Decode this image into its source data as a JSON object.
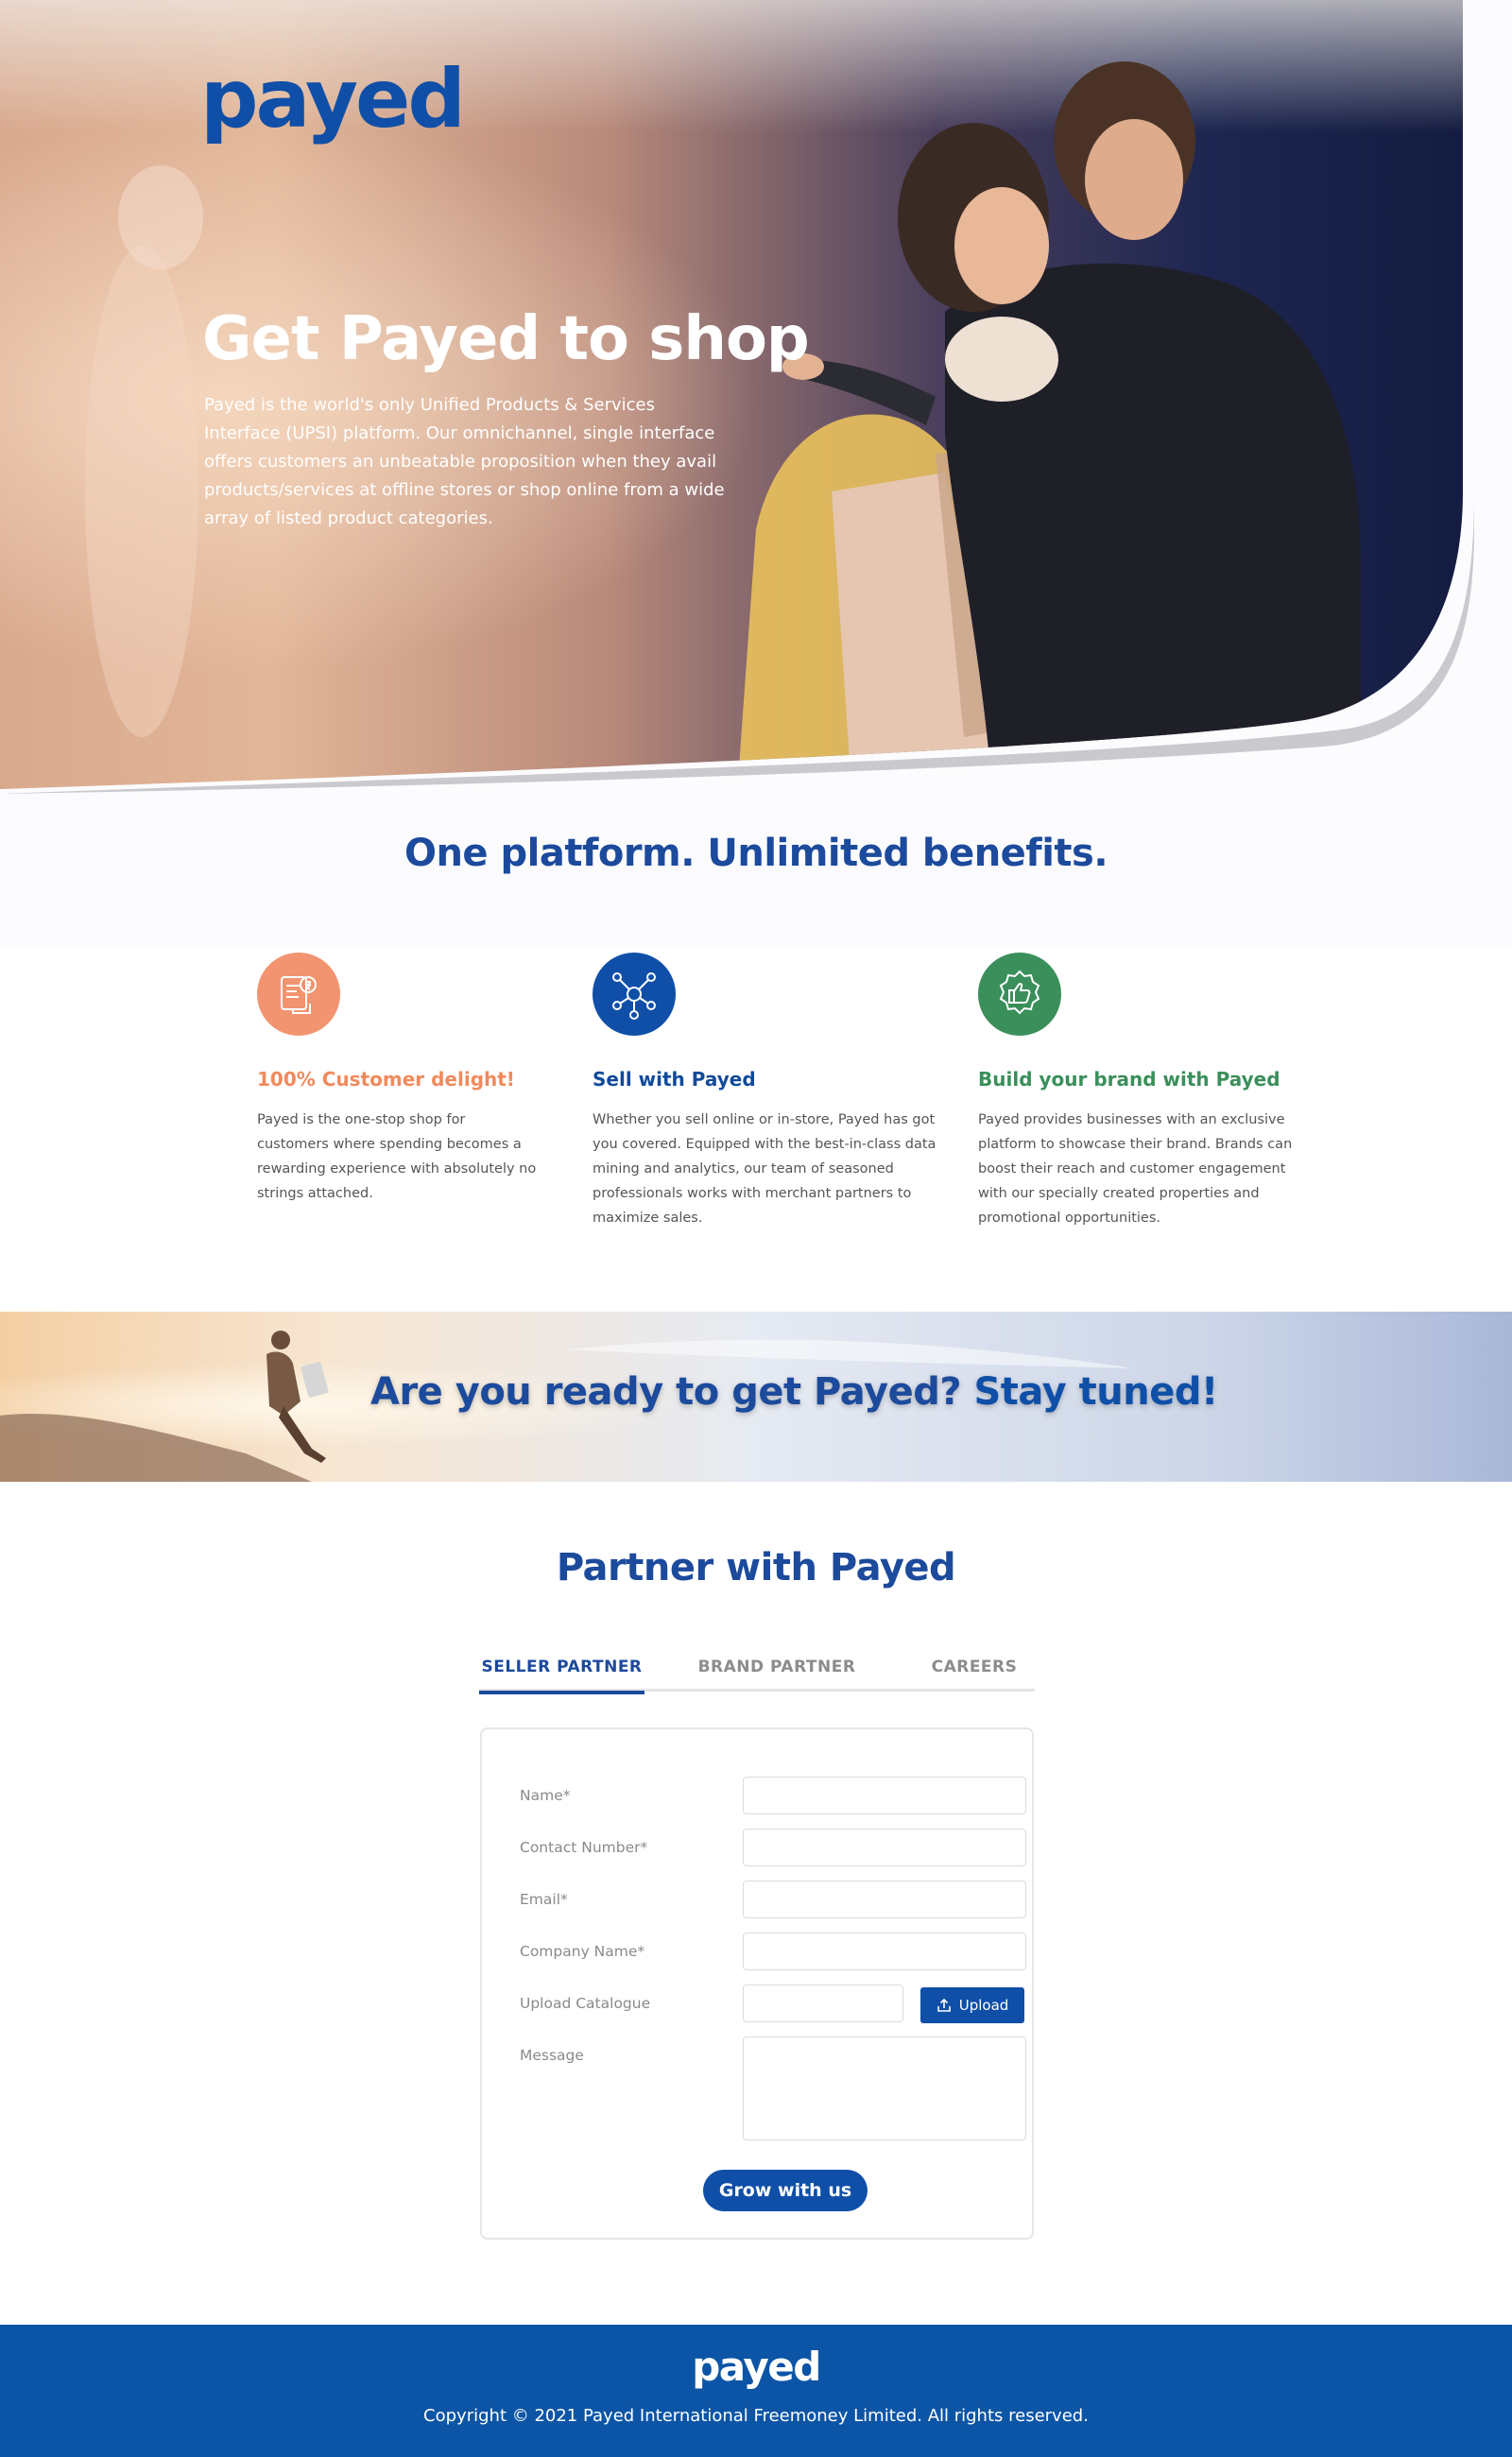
{
  "brand": {
    "logo_text": "payed",
    "color_primary": "#0f4fa8",
    "color_title": "#1c4a9c",
    "color_orange": "#f08a5c",
    "color_green": "#3a8f5a"
  },
  "hero": {
    "title": "Get Payed to shop",
    "description": "Payed is the world's only Unified Products & Services Interface (UPSI) platform. Our omnichannel, single interface offers customers an unbeatable proposition when they avail products/services at offline stores or shop online from a wide array of listed product categories."
  },
  "benefits": {
    "title": "One platform. Unlimited benefits.",
    "items": [
      {
        "icon": "receipt-rupee-icon",
        "heading": "100% Customer delight!",
        "text": "Payed is the one-stop shop for customers where spending becomes a rewarding experience with absolutely no strings attached."
      },
      {
        "icon": "network-hub-icon",
        "heading": "Sell with Payed",
        "text": "Whether you sell online or in-store, Payed has got you covered. Equipped with the best-in-class data mining and analytics, our team of seasoned professionals works with merchant partners to maximize sales."
      },
      {
        "icon": "thumbs-up-badge-icon",
        "heading": "Build your brand with Payed",
        "text": "Payed provides businesses with an exclusive platform to showcase their brand. Brands can boost their reach and customer engagement with our specially created properties and promotional opportunities."
      }
    ]
  },
  "banner": {
    "text_part1": "Are you ready to get Payed? ",
    "text_part2": "Stay tuned!"
  },
  "partner": {
    "title": "Partner with Payed",
    "tabs": [
      {
        "label": "SELLER PARTNER",
        "active": true
      },
      {
        "label": "BRAND PARTNER",
        "active": false
      },
      {
        "label": "CAREERS",
        "active": false
      }
    ],
    "form": {
      "name_label": "Name*",
      "contact_label": "Contact Number*",
      "email_label": "Email*",
      "company_label": "Company Name*",
      "upload_label": "Upload Catalogue",
      "upload_button": "Upload",
      "message_label": "Message",
      "submit_label": "Grow with us",
      "name_value": "",
      "contact_value": "",
      "email_value": "",
      "company_value": "",
      "message_value": ""
    }
  },
  "footer": {
    "logo_text": "payed",
    "copyright": "Copyright © 2021 Payed International Freemoney Limited. All rights reserved."
  }
}
